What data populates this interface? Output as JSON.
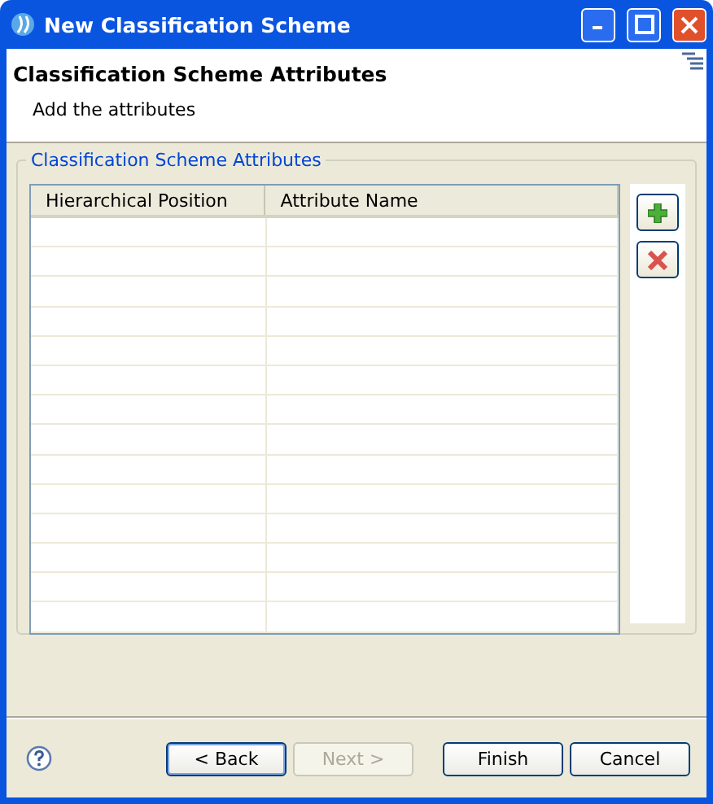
{
  "window": {
    "title": "New Classification Scheme"
  },
  "header": {
    "title": "Classification Scheme Attributes",
    "subtitle": "Add the attributes"
  },
  "group": {
    "label": "Classification Scheme Attributes"
  },
  "table": {
    "columns": [
      "Hierarchical Position",
      "Attribute Name"
    ]
  },
  "side_buttons": [
    {
      "kind": "add"
    },
    {
      "kind": "remove"
    }
  ],
  "buttons": [
    {
      "label": "< Back",
      "disabled": false,
      "default": true
    },
    {
      "label": "Next >",
      "disabled": true,
      "default": false
    },
    {
      "label": "Finish",
      "disabled": false,
      "default": false
    },
    {
      "label": "Cancel",
      "disabled": false,
      "default": false
    }
  ]
}
